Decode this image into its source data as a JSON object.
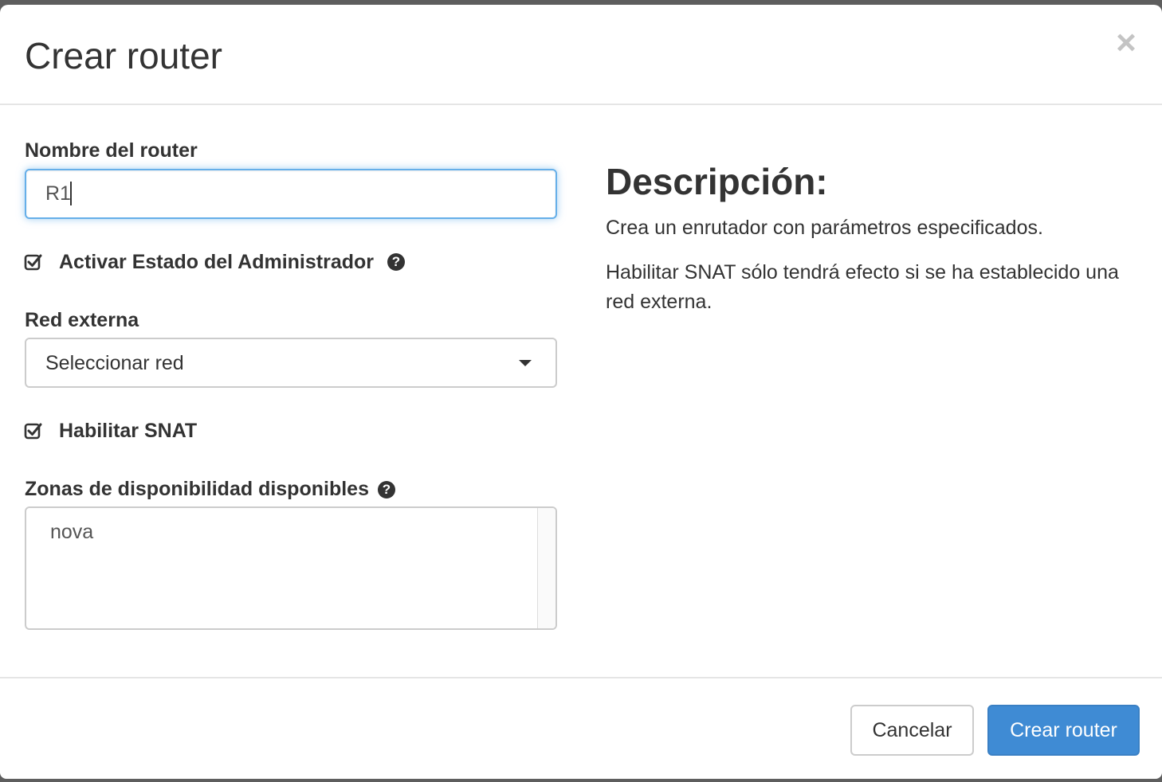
{
  "modal": {
    "title": "Crear router",
    "close_icon": "close-icon"
  },
  "form": {
    "router_name": {
      "label": "Nombre del router",
      "value": "R1"
    },
    "admin_state": {
      "label": "Activar Estado del Administrador",
      "checked": true,
      "help_icon": "question-circle-icon"
    },
    "external_network": {
      "label": "Red externa",
      "selected": "Seleccionar red"
    },
    "snat": {
      "label": "Habilitar SNAT",
      "checked": true
    },
    "availability_zones": {
      "label": "Zonas de disponibilidad disponibles",
      "help_icon": "question-circle-icon",
      "options": [
        "nova"
      ]
    }
  },
  "description": {
    "heading": "Descripción:",
    "paragraph1": "Crea un enrutador con parámetros especificados.",
    "paragraph2": "Habilitar SNAT sólo tendrá efecto si se ha establecido una red externa."
  },
  "footer": {
    "cancel_label": "Cancelar",
    "submit_label": "Crear router"
  },
  "colors": {
    "primary": "#3f8bd4",
    "focus_border": "#66afe9"
  }
}
